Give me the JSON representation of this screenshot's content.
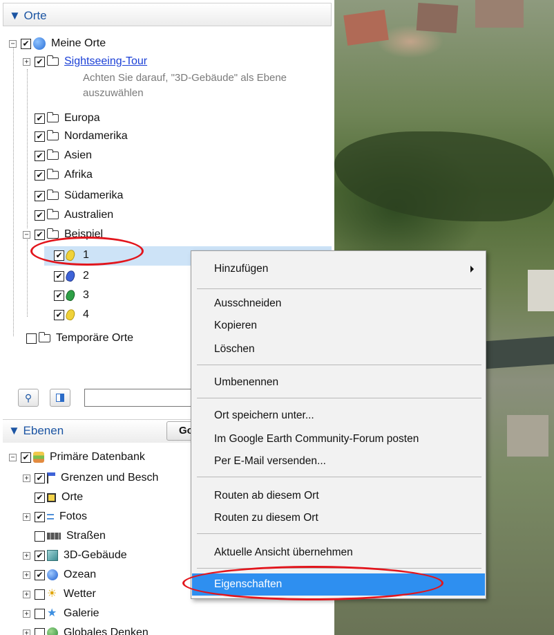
{
  "places_panel": {
    "header": "▼ Orte",
    "root": "Meine Orte",
    "sightseeing": "Sightseeing-Tour",
    "sightseeing_desc": "Achten Sie darauf, \"3D-Gebäude\" als Ebene auszuwählen",
    "folders": [
      "Europa",
      "Nordamerika",
      "Asien",
      "Afrika",
      "Südamerika",
      "Australien"
    ],
    "example_folder": "Beispiel",
    "placemarks": [
      "1",
      "2",
      "3",
      "4"
    ],
    "temporary": "Temporäre Orte"
  },
  "search": {
    "value": ""
  },
  "layers_panel": {
    "header": "▼ Ebenen",
    "go_button": "Go",
    "items": [
      "Primäre Datenbank",
      "Grenzen und Besch",
      "Orte",
      "Fotos",
      "Straßen",
      "3D-Gebäude",
      "Ozean",
      "Wetter",
      "Galerie",
      "Globales Denken"
    ]
  },
  "context_menu": {
    "items": [
      "Hinzufügen",
      "Ausschneiden",
      "Kopieren",
      "Löschen",
      "Umbenennen",
      "Ort speichern unter...",
      "Im Google Earth Community-Forum posten",
      "Per E-Mail versenden...",
      "Routen ab diesem Ort",
      "Routen zu diesem Ort",
      "Aktuelle Ansicht übernehmen",
      "Eigenschaften"
    ]
  },
  "colors": {
    "highlight": "#2e8ff0",
    "annotation": "#e2151c",
    "header_text": "#1c55a3"
  }
}
